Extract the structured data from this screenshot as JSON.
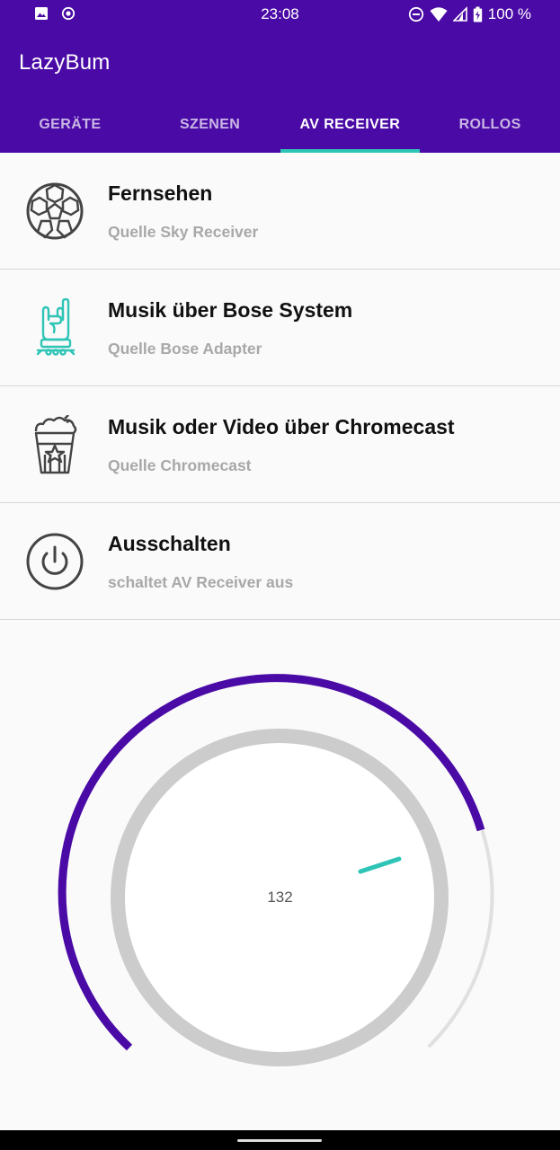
{
  "status_bar": {
    "time": "23:08",
    "battery_text": "100 %",
    "icons": [
      "image-icon",
      "record-icon",
      "do-not-disturb-icon",
      "wifi-icon",
      "signal-icon",
      "battery-icon"
    ]
  },
  "app": {
    "title": "LazyBum"
  },
  "tabs": [
    {
      "label": "GERÄTE",
      "active": false
    },
    {
      "label": "SZENEN",
      "active": false
    },
    {
      "label": "AV RECEIVER",
      "active": true
    },
    {
      "label": "ROLLOS",
      "active": false
    }
  ],
  "items": [
    {
      "title": "Fernsehen",
      "subtitle": "Quelle Sky Receiver",
      "icon": "soccer-ball-icon"
    },
    {
      "title": "Musik über Bose System",
      "subtitle": "Quelle Bose Adapter",
      "icon": "rock-hand-icon"
    },
    {
      "title": "Musik oder Video über Chromecast",
      "subtitle": "Quelle Chromecast",
      "icon": "popcorn-icon"
    },
    {
      "title": "Ausschalten",
      "subtitle": "schaltet AV Receiver aus",
      "icon": "power-icon"
    }
  ],
  "volume_knob": {
    "value": "132"
  },
  "colors": {
    "primary": "#4a0aa6",
    "accent": "#2ec4b6",
    "knob_ring": "#cccccc",
    "track": "#e0e0e0"
  }
}
